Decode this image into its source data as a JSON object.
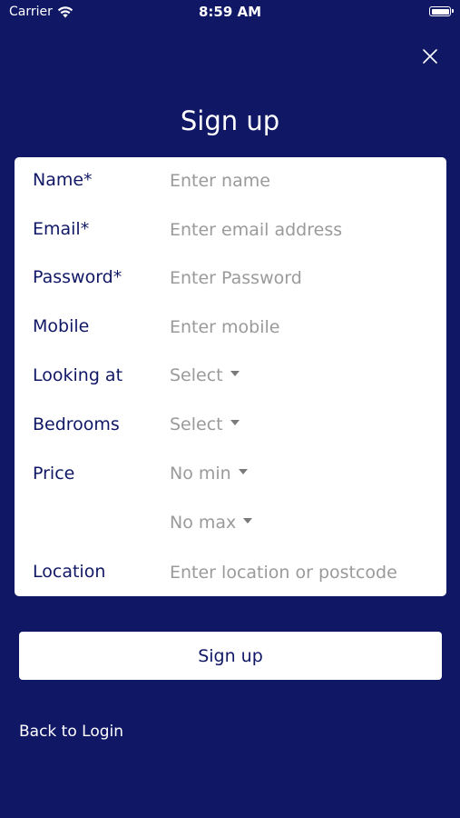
{
  "status_bar": {
    "carrier": "Carrier",
    "time": "8:59 AM"
  },
  "header": {
    "title": "Sign up"
  },
  "form": {
    "name": {
      "label": "Name*",
      "placeholder": "Enter name"
    },
    "email": {
      "label": "Email*",
      "placeholder": "Enter email address"
    },
    "password": {
      "label": "Password*",
      "placeholder": "Enter Password"
    },
    "mobile": {
      "label": "Mobile",
      "placeholder": "Enter mobile"
    },
    "looking_at": {
      "label": "Looking at",
      "value": "Select"
    },
    "bedrooms": {
      "label": "Bedrooms",
      "value": "Select"
    },
    "price": {
      "label": "Price",
      "min_value": "No min",
      "max_value": "No max"
    },
    "location": {
      "label": "Location",
      "placeholder": "Enter location or postcode"
    }
  },
  "actions": {
    "signup_label": "Sign up",
    "back_label": "Back to Login"
  },
  "colors": {
    "background": "#101866",
    "card": "#ffffff",
    "label_text": "#101866",
    "placeholder_text": "#9a9a9a"
  },
  "icons": {
    "wifi": "wifi-icon",
    "battery": "battery-icon",
    "close": "close-icon",
    "dropdown": "caret-down-icon"
  }
}
